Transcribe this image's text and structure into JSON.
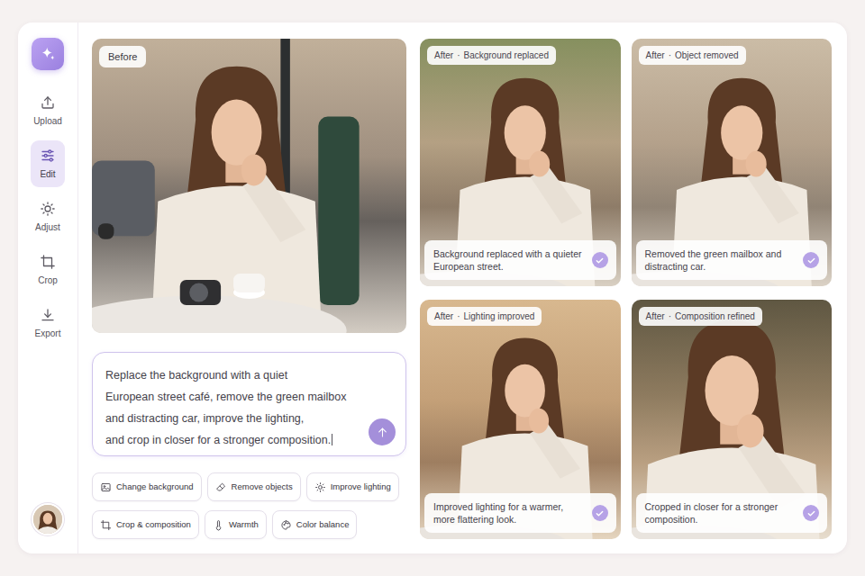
{
  "sidebar": {
    "items": [
      {
        "label": "Upload",
        "selected": false
      },
      {
        "label": "Edit",
        "selected": true
      },
      {
        "label": "Adjust",
        "selected": false
      },
      {
        "label": "Crop",
        "selected": false
      },
      {
        "label": "Export",
        "selected": false
      }
    ]
  },
  "before": {
    "badge": "Before"
  },
  "prompt": {
    "text": "Replace the background with a quiet\nEuropean street café, remove the green mailbox\nand distracting car, improve the lighting,\nand crop in closer for a stronger composition."
  },
  "chips": [
    {
      "label": "Change background"
    },
    {
      "label": "Remove objects"
    },
    {
      "label": "Improve lighting"
    },
    {
      "label": "Crop & composition"
    },
    {
      "label": "Warmth"
    },
    {
      "label": "Color balance"
    }
  ],
  "results": [
    {
      "status": "After",
      "separator": "·",
      "title": "Background replaced",
      "caption": "Background replaced with a quieter European street.",
      "done": true
    },
    {
      "status": "After",
      "separator": "·",
      "title": "Object removed",
      "caption": "Removed the green mailbox and distracting car.",
      "done": true
    },
    {
      "status": "After",
      "separator": "·",
      "title": "Lighting improved",
      "caption": "Improved lighting for a warmer, more flattering look.",
      "done": true
    },
    {
      "status": "After",
      "separator": "·",
      "title": "Composition refined",
      "caption": "Cropped in closer for a stronger composition.",
      "done": true
    }
  ]
}
